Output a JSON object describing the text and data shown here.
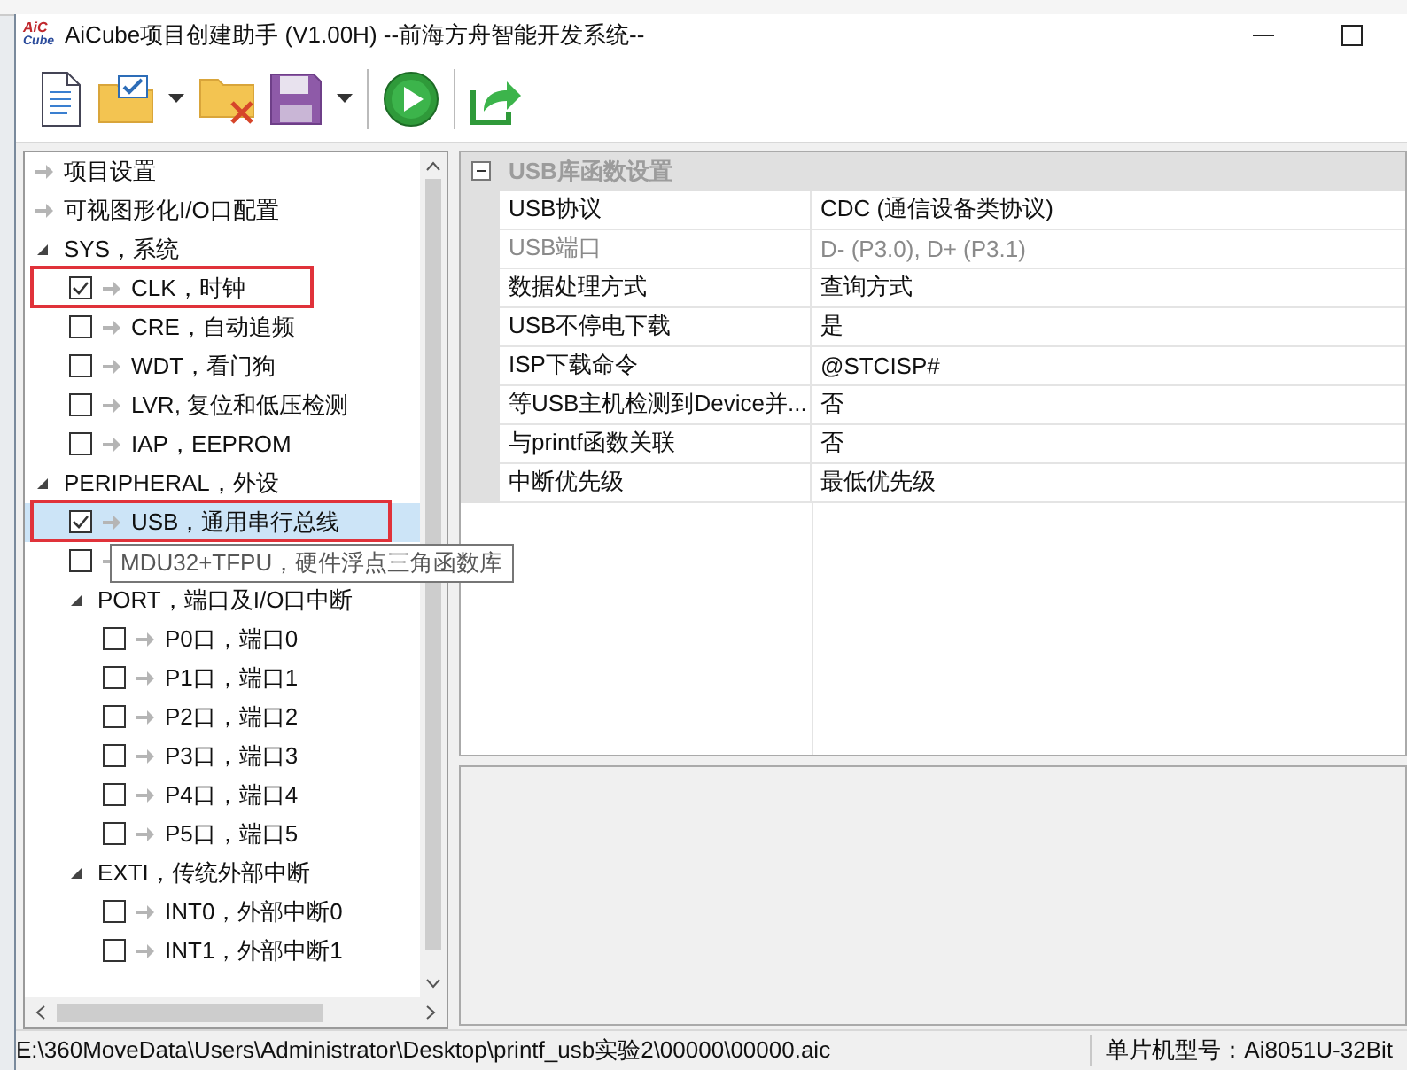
{
  "window": {
    "title": "AiCube项目创建助手 (V1.00H) --前海方舟智能开发系统--",
    "logo": [
      "AiC",
      "Cube"
    ]
  },
  "tree": [
    {
      "kind": "link",
      "label": "项目设置"
    },
    {
      "kind": "link",
      "label": "可视图形化I/O口配置"
    },
    {
      "kind": "group",
      "label": "SYS，系统",
      "expanded": true,
      "children": [
        {
          "kind": "check",
          "label": "CLK，时钟",
          "checked": true,
          "highlighted": true,
          "selected": false
        },
        {
          "kind": "check",
          "label": "CRE，自动追频",
          "checked": false,
          "highlighted": false,
          "selected": false
        },
        {
          "kind": "check",
          "label": "WDT，看门狗",
          "checked": false,
          "highlighted": false,
          "selected": false
        },
        {
          "kind": "check",
          "label": "LVR, 复位和低压检测",
          "checked": false,
          "highlighted": false,
          "selected": false
        },
        {
          "kind": "check",
          "label": "IAP，EEPROM",
          "checked": false,
          "highlighted": false,
          "selected": false
        }
      ]
    },
    {
      "kind": "group",
      "label": "PERIPHERAL，外设",
      "expanded": true,
      "children": [
        {
          "kind": "check",
          "label": "USB，通用串行总线",
          "checked": true,
          "highlighted": true,
          "selected": true
        },
        {
          "kind": "check",
          "label": "MDU32+TFPU，硬件浮点三角函数库",
          "checked": false,
          "highlighted": false,
          "selected": false,
          "tooltip": true
        },
        {
          "kind": "group",
          "label": "PORT，端口及I/O口中断",
          "expanded": true,
          "children": [
            {
              "kind": "check",
              "label": "P0口，端口0",
              "checked": false,
              "highlighted": false,
              "selected": false
            },
            {
              "kind": "check",
              "label": "P1口，端口1",
              "checked": false,
              "highlighted": false,
              "selected": false
            },
            {
              "kind": "check",
              "label": "P2口，端口2",
              "checked": false,
              "highlighted": false,
              "selected": false
            },
            {
              "kind": "check",
              "label": "P3口，端口3",
              "checked": false,
              "highlighted": false,
              "selected": false
            },
            {
              "kind": "check",
              "label": "P4口，端口4",
              "checked": false,
              "highlighted": false,
              "selected": false
            },
            {
              "kind": "check",
              "label": "P5口，端口5",
              "checked": false,
              "highlighted": false,
              "selected": false
            }
          ]
        },
        {
          "kind": "group",
          "label": "EXTI，传统外部中断",
          "expanded": true,
          "children": [
            {
              "kind": "check",
              "label": "INT0，外部中断0",
              "checked": false,
              "highlighted": false,
              "selected": false
            },
            {
              "kind": "check",
              "label": "INT1，外部中断1",
              "checked": false,
              "highlighted": false,
              "selected": false
            }
          ]
        }
      ]
    }
  ],
  "properties": {
    "category": "USB库函数设置",
    "expanded": true,
    "rows": [
      {
        "name": "USB协议",
        "value": "CDC (通信设备类协议)",
        "disabled": false
      },
      {
        "name": "USB端口",
        "value": "D- (P3.0), D+ (P3.1)",
        "disabled": true
      },
      {
        "name": "数据处理方式",
        "value": "查询方式",
        "disabled": false
      },
      {
        "name": "USB不停电下载",
        "value": "是",
        "disabled": false
      },
      {
        "name": "ISP下载命令",
        "value": "@STCISP#",
        "disabled": false
      },
      {
        "name": "等USB主机检测到Device并...",
        "value": "否",
        "disabled": false
      },
      {
        "name": "与printf函数关联",
        "value": "否",
        "disabled": false
      },
      {
        "name": "中断优先级",
        "value": "最低优先级",
        "disabled": false
      }
    ]
  },
  "status_bar": {
    "path": "E:\\360MoveData\\Users\\Administrator\\Desktop\\printf_usb实验2\\00000\\00000.aic",
    "chip": "单片机型号：Ai8051U-32Bit"
  }
}
